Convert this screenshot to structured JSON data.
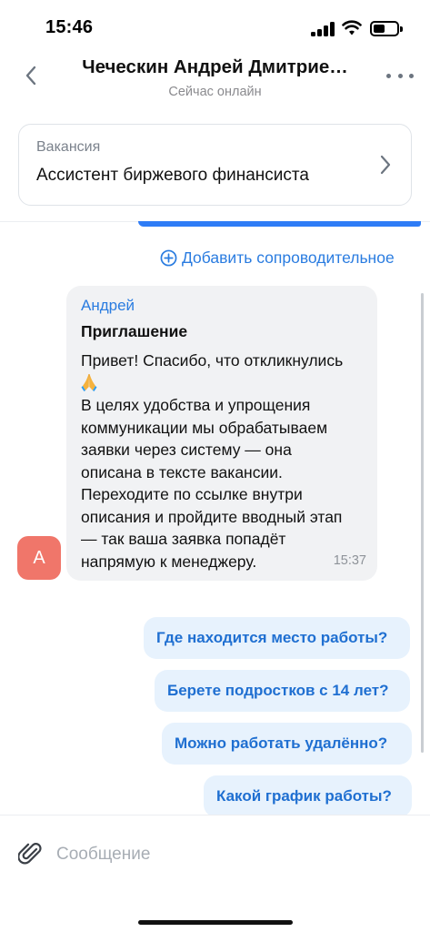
{
  "status_bar": {
    "time": "15:46",
    "icons": [
      "cellular-signal-icon",
      "wifi-icon",
      "battery-icon"
    ]
  },
  "header": {
    "title": "Чеческин Андрей Дмитрие…",
    "status": "Сейчас онлайн",
    "back_icon": "chevron-left-icon",
    "more_icon": "more-horizontal-icon"
  },
  "vacancy": {
    "label": "Вакансия",
    "title": "Ассистент биржевого финансиста",
    "icon": "chevron-right-icon"
  },
  "chat": {
    "add_cover_letter": "Добавить сопроводительное",
    "add_cover_icon": "plus-circle-icon",
    "incoming": {
      "avatar_letter": "А",
      "sender": "Андрей",
      "heading": "Приглашение",
      "lines": [
        "Привет! Спасибо, что откликнулись",
        "В целях удобства и упрощения",
        "коммуникации мы обрабатываем",
        "заявки через систему — она",
        "описана в тексте вакансии.",
        "Переходите по ссылке внутри",
        "описания и пройдите вводный этап",
        "— так ваша заявка попадёт",
        "напрямую к менеджеру."
      ],
      "emoji_icon": "folded-hands-emoji-icon",
      "time": "15:37"
    },
    "suggestions": [
      "Где находится место работы?",
      "Берете подростков с 14 лет?",
      "Можно работать удалённо?",
      "Какой график работы?"
    ]
  },
  "composer": {
    "placeholder": "Сообщение",
    "attach_icon": "paperclip-icon"
  },
  "colors": {
    "accent": "#2a7ce0",
    "outgoing_bubble": "#2e7cf6",
    "incoming_bubble": "#f1f2f4",
    "suggestion_bg": "#e7f2fd",
    "avatar": "#f0766a"
  }
}
